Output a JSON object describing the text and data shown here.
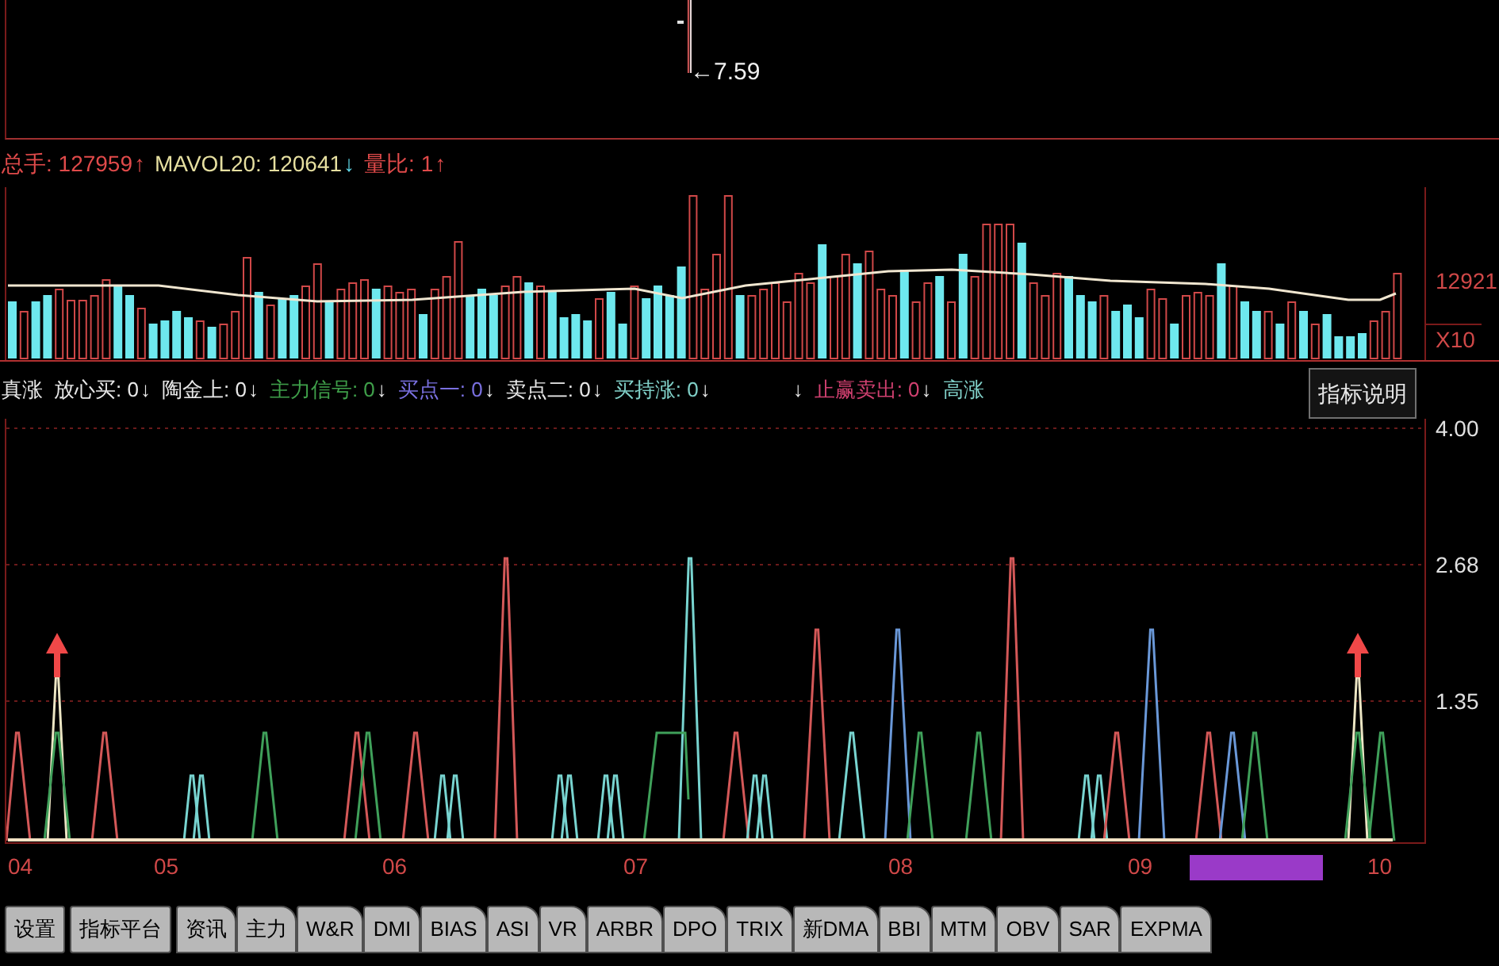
{
  "price_panel": {
    "price_label": "←7.59"
  },
  "volume_panel": {
    "legend": [
      {
        "text": "总手: 127959",
        "color": "#e04a4a",
        "arrow": {
          "symbol": "↑",
          "color": "#e04a4a"
        }
      },
      {
        "text": "MAVOL20: 120641",
        "color": "#e6dfa0",
        "arrow": {
          "symbol": "↓",
          "color": "#5fd8e8"
        }
      },
      {
        "text": "量比: 1",
        "color": "#e04a4a",
        "arrow": {
          "symbol": "↑",
          "color": "#e04a4a"
        }
      }
    ],
    "axis_labels": [
      "12921",
      "X10"
    ]
  },
  "indicator_panel": {
    "legend": [
      {
        "text": "真涨",
        "color": "#e8e8e8"
      },
      {
        "text": "放心买: 0",
        "color": "#e8e8e8",
        "arrow": {
          "symbol": "↓",
          "color": "#e8e8e8"
        }
      },
      {
        "text": "陶金上: 0",
        "color": "#e8e8e8",
        "arrow": {
          "symbol": "↓",
          "color": "#e8e8e8"
        }
      },
      {
        "text": "主力信号: 0",
        "color": "#3fa04a",
        "arrow": {
          "symbol": "↓",
          "color": "#e8e8e8"
        }
      },
      {
        "text": "买点一: 0",
        "color": "#7a70e0",
        "arrow": {
          "symbol": "↓",
          "color": "#e8e8e8"
        }
      },
      {
        "text": "卖点二: 0",
        "color": "#e8e8e8",
        "arrow": {
          "symbol": "↓",
          "color": "#e8e8e8"
        }
      },
      {
        "text": "买持涨: 0",
        "color": "#80d0c8",
        "arrow": {
          "symbol": "↓",
          "color": "#e8e8e8"
        }
      },
      {
        "arrow": {
          "symbol": "↓",
          "color": "#e8e8e8"
        }
      },
      {
        "text": "止赢卖出: 0",
        "color": "#d04070",
        "arrow": {
          "symbol": "↓",
          "color": "#e8e8e8"
        }
      },
      {
        "text": "高涨",
        "color": "#80d0c8"
      }
    ],
    "help_button": "指标说明",
    "axis_labels": [
      "4.00",
      "2.68",
      "1.35"
    ]
  },
  "date_axis": {
    "labels": [
      "04",
      "05",
      "06",
      "07",
      "08",
      "09",
      "10"
    ]
  },
  "tabs": [
    {
      "label": "设置",
      "kind": "button",
      "selected": false
    },
    {
      "label": "指标平台",
      "kind": "button",
      "selected": false
    },
    {
      "label": "资讯",
      "kind": "tab",
      "selected": false
    },
    {
      "label": "主力",
      "kind": "tab",
      "selected": false
    },
    {
      "label": "W&R",
      "kind": "tab",
      "selected": false
    },
    {
      "label": "DMI",
      "kind": "tab",
      "selected": false
    },
    {
      "label": "BIAS",
      "kind": "tab",
      "selected": false
    },
    {
      "label": "ASI",
      "kind": "tab",
      "selected": false
    },
    {
      "label": "VR",
      "kind": "tab",
      "selected": false
    },
    {
      "label": "ARBR",
      "kind": "tab",
      "selected": false
    },
    {
      "label": "DPO",
      "kind": "tab",
      "selected": false
    },
    {
      "label": "TRIX",
      "kind": "tab",
      "selected": false
    },
    {
      "label": "新DMA",
      "kind": "tab",
      "selected": false
    },
    {
      "label": "BBI",
      "kind": "tab",
      "selected": false
    },
    {
      "label": "MTM",
      "kind": "tab",
      "selected": false
    },
    {
      "label": "OBV",
      "kind": "tab",
      "selected": false
    },
    {
      "label": "SAR",
      "kind": "tab",
      "selected": false
    },
    {
      "label": "EXPMA",
      "kind": "tab",
      "selected": false
    }
  ]
}
